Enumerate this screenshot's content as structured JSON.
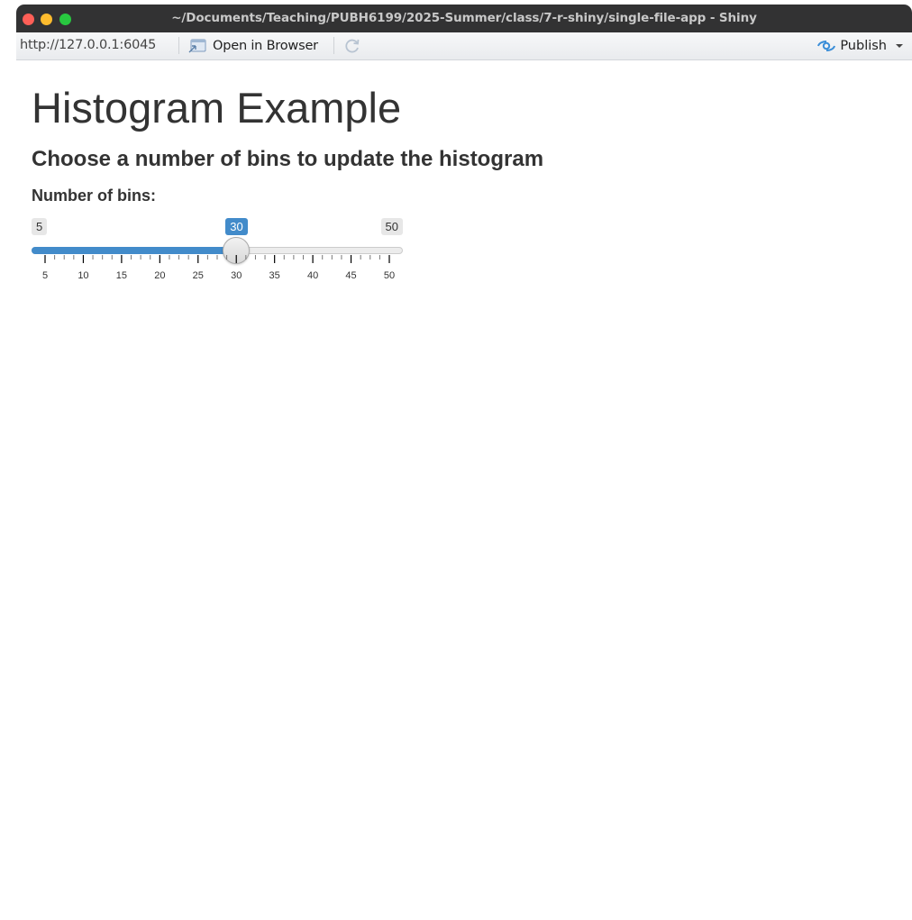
{
  "window": {
    "title": "~/Documents/Teaching/PUBH6199/2025-Summer/class/7-r-shiny/single-file-app - Shiny"
  },
  "toolbar": {
    "url": "http://127.0.0.1:6045",
    "open_in_browser_label": "Open in Browser",
    "publish_label": "Publish",
    "open_icon": "open-in-browser-icon",
    "refresh_icon": "refresh-icon",
    "publish_icon": "publish-icon"
  },
  "app": {
    "title": "Histogram Example",
    "subtitle": "Choose a number of bins to update the histogram",
    "slider": {
      "label": "Number of bins:",
      "min": 5,
      "max": 50,
      "value": 30,
      "ticks": [
        "5",
        "10",
        "15",
        "20",
        "25",
        "30",
        "35",
        "40",
        "45",
        "50"
      ],
      "accent_color": "#428bca"
    }
  }
}
